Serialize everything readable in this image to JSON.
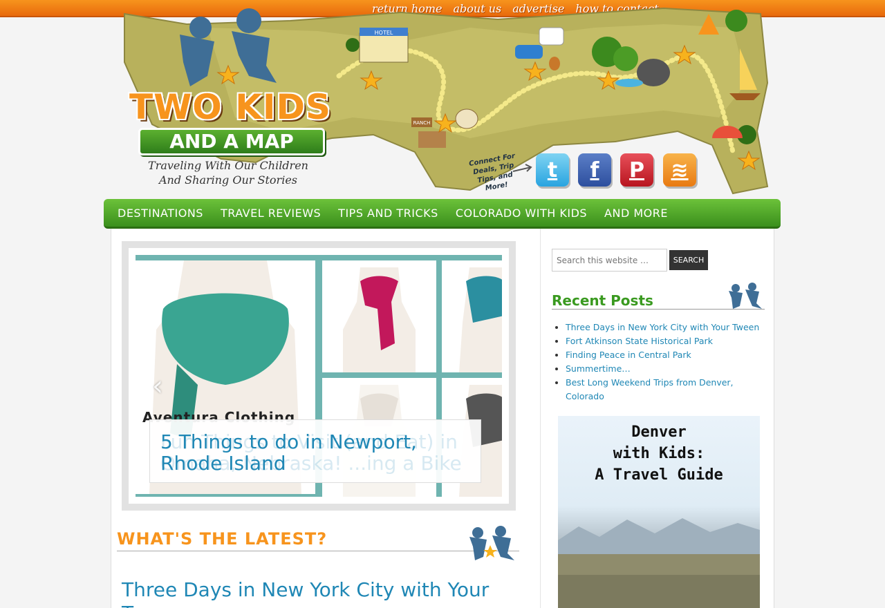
{
  "topnav": [
    "return home",
    "about us",
    "advertise",
    "how to contact"
  ],
  "header": {
    "logo_title": "TWO KIDS",
    "logo_sub": "AND A MAP",
    "tagline": "Traveling With Our Children And Sharing Our Stories",
    "connect": "Connect For Deals, Trip Tips, and More!",
    "social": {
      "twitter": "t",
      "facebook": "f",
      "pinterest": "P",
      "rss": "≋"
    },
    "sign_label": "RANCH",
    "hotel_label": "HOTEL"
  },
  "mainnav": [
    "DESTINATIONS",
    "TRAVEL REVIEWS",
    "TIPS AND TRICKS",
    "COLORADO WITH KIDS",
    "AND MORE"
  ],
  "slider": {
    "brand_text": "Aventura Clothing",
    "caption": "5 Things to do in Newport, Rhode Island",
    "caption_ghost": "Fun Things to Visit (and Eat) in Omaha, Nebraska! ...ing a Bike"
  },
  "latest": {
    "heading": "WHAT'S THE LATEST?",
    "post_title": "Three Days in New York City with Your T..."
  },
  "sidebar": {
    "search_placeholder": "Search this website …",
    "search_button": "SEARCH",
    "recent_heading": "Recent Posts",
    "recent_posts": [
      "Three Days in New York City with Your Tween",
      "Fort Atkinson State Historical Park",
      "Finding Peace in Central Park",
      "Summertime…",
      "Best Long Weekend Trips from Denver, Colorado"
    ],
    "ad_lines": [
      "Denver",
      "with Kids:",
      "A Travel Guide"
    ]
  },
  "colors": {
    "orange": "#f7941d",
    "green": "#3a8f1c",
    "link_blue": "#1f87b5"
  }
}
